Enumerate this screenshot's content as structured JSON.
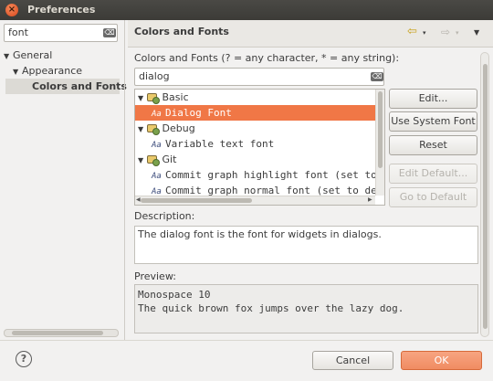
{
  "window": {
    "title": "Preferences",
    "close_glyph": "×"
  },
  "sidebar": {
    "filter_value": "font",
    "clear_glyph": "⌫",
    "tree": [
      {
        "label": "General",
        "arrow": "▼"
      },
      {
        "label": "Appearance",
        "arrow": "▼"
      },
      {
        "label": "Colors and Fonts",
        "arrow": ""
      }
    ]
  },
  "page": {
    "title": "Colors and Fonts",
    "back_glyph": "⇦",
    "forward_glyph": "⇨",
    "dropdown_glyph": "▾",
    "menu_glyph": "▼",
    "instructions": "Colors and Fonts (? = any character, * = any string):",
    "search_value": "dialog",
    "clear_glyph": "⌫"
  },
  "tree": {
    "rows": [
      {
        "type": "category",
        "label": "Basic",
        "arrow": "▼"
      },
      {
        "type": "font",
        "label": "Dialog Font",
        "icon": "Aa",
        "selected": true
      },
      {
        "type": "category",
        "label": "Debug",
        "arrow": "▼"
      },
      {
        "type": "font",
        "label": "Variable text font",
        "icon": "Aa"
      },
      {
        "type": "category",
        "label": "Git",
        "arrow": "▼"
      },
      {
        "type": "font",
        "label": "Commit graph highlight font (set to def",
        "icon": "Aa"
      },
      {
        "type": "font",
        "label": "Commit graph normal font (set to defau",
        "icon": "Aa"
      }
    ]
  },
  "buttons": {
    "edit": "Edit...",
    "use_system_font": "Use System Font",
    "reset": "Reset",
    "edit_default": "Edit Default...",
    "go_to_default": "Go to Default"
  },
  "description": {
    "label": "Description:",
    "text": "The dialog font is the font for widgets in dialogs."
  },
  "preview": {
    "label": "Preview:",
    "line1": "Monospace 10",
    "line2": "The quick brown fox jumps over the lazy dog."
  },
  "footer": {
    "help_glyph": "?",
    "cancel": "Cancel",
    "ok": "OK"
  },
  "colors": {
    "selection": "#f07746",
    "ok_button": "#f08c62",
    "titlebar": "#3c3b37"
  }
}
